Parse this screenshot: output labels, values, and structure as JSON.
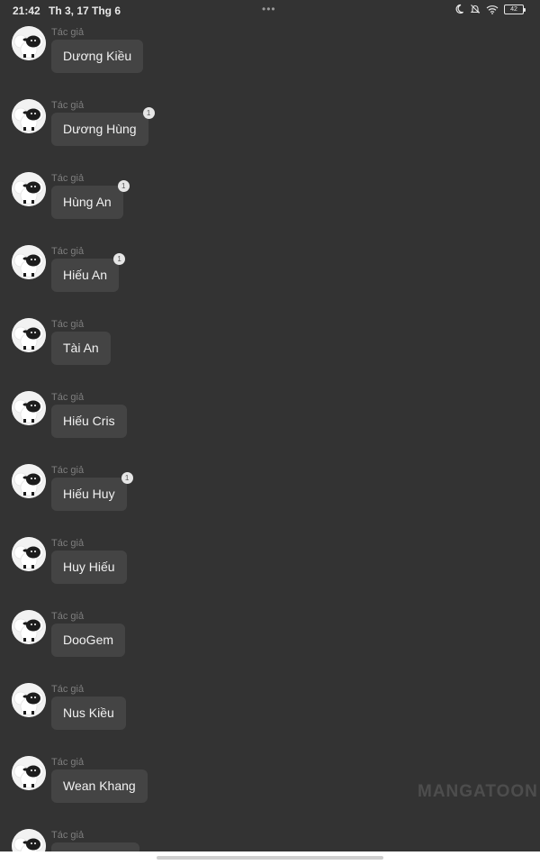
{
  "status_bar": {
    "time": "21:42",
    "date": "Th 3, 17 Thg 6",
    "battery": "42",
    "icons": [
      "moon-icon",
      "bell-off-icon",
      "wifi-icon",
      "battery-icon"
    ]
  },
  "messages": [
    {
      "role": "Tác giả",
      "name": "Dương Kiều",
      "badge": ""
    },
    {
      "role": "Tác giả",
      "name": "Dương Hùng",
      "badge": "1"
    },
    {
      "role": "Tác giả",
      "name": "Hùng An",
      "badge": "1"
    },
    {
      "role": "Tác giả",
      "name": "Hiếu An",
      "badge": "1"
    },
    {
      "role": "Tác giả",
      "name": "Tài An",
      "badge": ""
    },
    {
      "role": "Tác giả",
      "name": "Hiếu Cris",
      "badge": ""
    },
    {
      "role": "Tác giả",
      "name": "Hiếu Huy",
      "badge": "1"
    },
    {
      "role": "Tác giả",
      "name": "Huy Hiếu",
      "badge": ""
    },
    {
      "role": "Tác giả",
      "name": "DooGem",
      "badge": ""
    },
    {
      "role": "Tác giả",
      "name": "Nus Kiều",
      "badge": ""
    },
    {
      "role": "Tác giả",
      "name": "Wean Khang",
      "badge": ""
    },
    {
      "role": "Tác giả",
      "name": "",
      "badge": ""
    }
  ],
  "watermark": "MANGATOON",
  "colors": {
    "background": "#333333",
    "bubble": "#444444",
    "text": "#f2f2f2",
    "role_text": "#7e7e7e"
  }
}
